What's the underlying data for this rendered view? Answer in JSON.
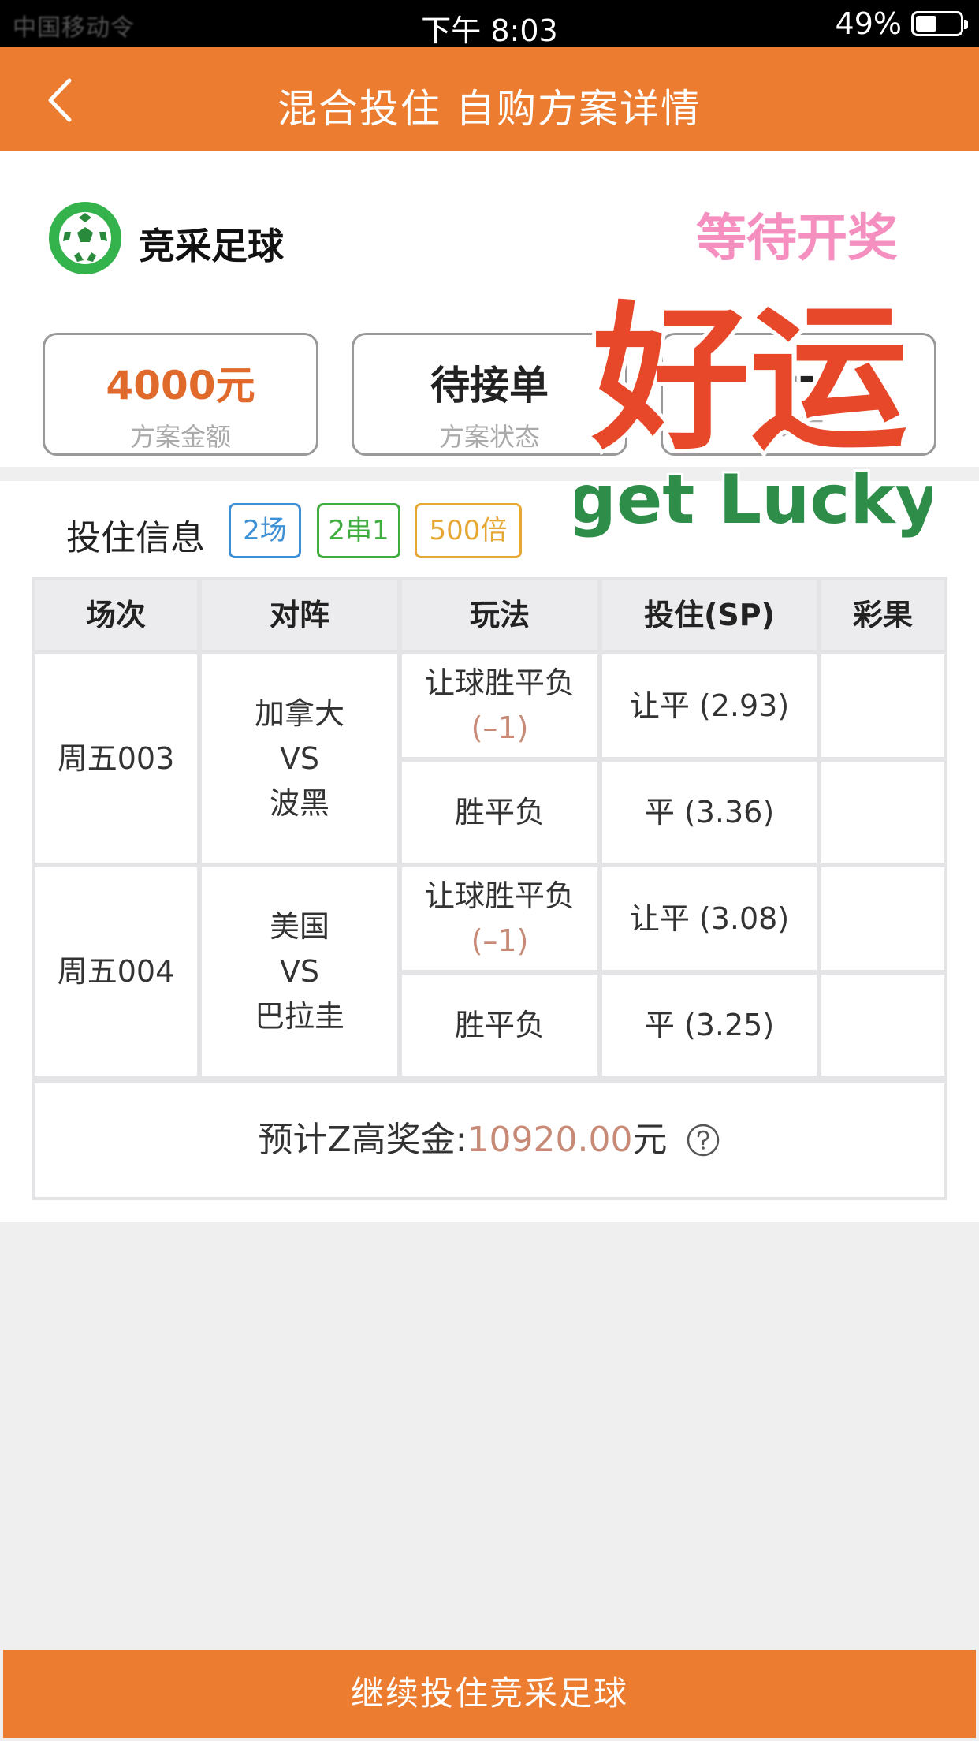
{
  "status_bar": {
    "carrier": "中国移动令",
    "time": "下午 8:03",
    "battery": "49%"
  },
  "header": {
    "title": "混合投住  自购方案详情"
  },
  "lottery": {
    "name": "竞采足球"
  },
  "stats": [
    {
      "value": "4000元",
      "label": "方案金额"
    },
    {
      "value": "待接单",
      "label": "方案状态"
    },
    {
      "value": "--",
      "label": "税后"
    }
  ],
  "sticker": {
    "top_text": "等待开奖",
    "main_text": "好运",
    "sub_text": "get Lucky"
  },
  "bet_info": {
    "title": "投住信息",
    "tags": [
      "2场",
      "2串1",
      "500倍"
    ]
  },
  "table": {
    "headers": [
      "场次",
      "对阵",
      "玩法",
      "投住(SP)",
      "彩果"
    ],
    "matches": [
      {
        "session": "周五003",
        "home": "加拿大",
        "vs": "VS",
        "away": "波黑",
        "plays": [
          {
            "name": "让球胜平负",
            "handicap": "(–1)",
            "bet": "让平 (2.93)",
            "result": ""
          },
          {
            "name": "胜平负",
            "bet": "平 (3.36)",
            "result": ""
          }
        ]
      },
      {
        "session": "周五004",
        "home": "美国",
        "vs": "VS",
        "away": "巴拉圭",
        "plays": [
          {
            "name": "让球胜平负",
            "handicap": "(–1)",
            "bet": "让平 (3.08)",
            "result": ""
          },
          {
            "name": "胜平负",
            "bet": "平 (3.25)",
            "result": ""
          }
        ]
      }
    ],
    "prize": {
      "label": "预计Z高奖金:",
      "amount": "10920.00",
      "unit": "元"
    }
  },
  "footer": {
    "button_label": "继续投住竞采足球"
  },
  "colors": {
    "brand_orange": "#ec7c30",
    "amount_orange": "#e06a2c",
    "handicap": "#c78a77"
  }
}
